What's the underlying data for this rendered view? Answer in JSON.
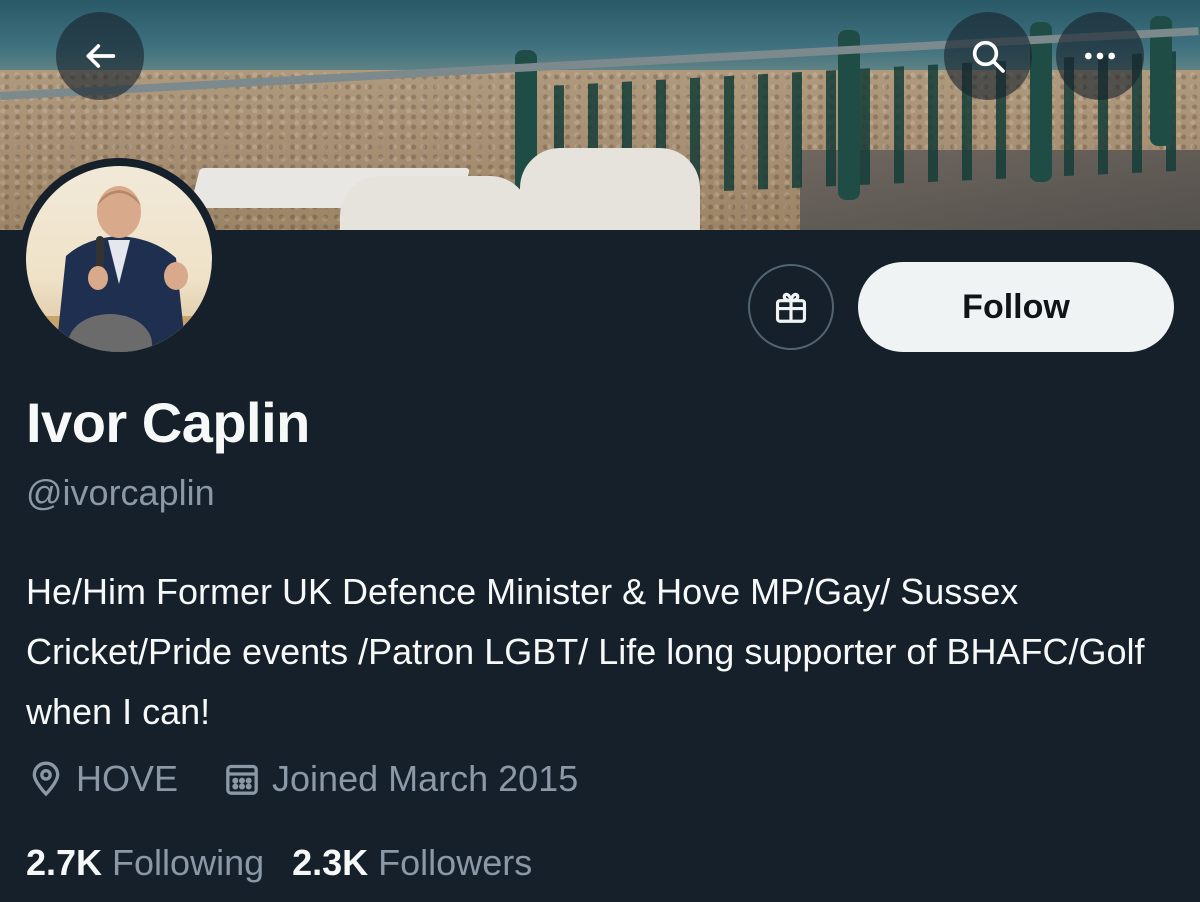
{
  "profile": {
    "name": "Ivor Caplin",
    "handle": "@ivorcaplin",
    "bio": "He/Him Former UK Defence Minister & Hove MP/Gay/ Sussex Cricket/Pride events /Patron LGBT/ Life long supporter of BHAFC/Golf when I can!",
    "location": "HOVE",
    "joined": "Joined March 2015"
  },
  "stats": {
    "following_count": "2.7K",
    "following_label": "Following",
    "followers_count": "2.3K",
    "followers_label": "Followers"
  },
  "actions": {
    "follow_label": "Follow"
  },
  "icons": {
    "back": "arrow-left-icon",
    "search": "search-icon",
    "more": "more-horizontal-icon",
    "gift": "gift-icon",
    "location": "location-pin-icon",
    "calendar": "calendar-icon"
  },
  "colors": {
    "background": "#15202b",
    "text_primary": "#f7f9f9",
    "text_secondary": "#8b98a5",
    "follow_button_bg": "#eff3f4",
    "follow_button_text": "#0f1419"
  }
}
